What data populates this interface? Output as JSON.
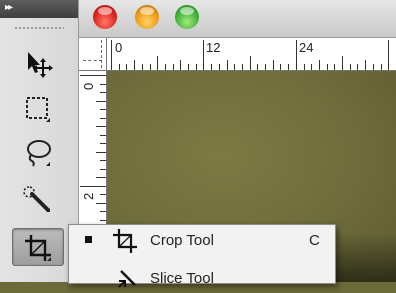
{
  "window": {
    "controls": [
      {
        "name": "close",
        "color": "#e0241c"
      },
      {
        "name": "minimize",
        "color": "#f09a12"
      },
      {
        "name": "zoom",
        "color": "#3fb23a"
      }
    ]
  },
  "tools_panel": {
    "collapse_glyph": "▸▸",
    "tools": [
      {
        "name": "move-tool",
        "icon": "move-arrow-icon"
      },
      {
        "name": "rectangular-marquee-tool",
        "icon": "marquee-icon"
      },
      {
        "name": "lasso-tool",
        "icon": "lasso-icon"
      },
      {
        "name": "quick-selection-tool",
        "icon": "quick-selection-icon"
      },
      {
        "name": "crop-tool",
        "icon": "crop-icon",
        "active": true
      }
    ]
  },
  "rulers": {
    "horizontal_labels": [
      "0",
      "12",
      "24"
    ],
    "vertical_labels": [
      "0",
      "2"
    ]
  },
  "flyout_menu": {
    "items": [
      {
        "label": "Crop Tool",
        "shortcut": "C",
        "icon": "crop-icon",
        "selected": true
      },
      {
        "label": "Slice Tool",
        "shortcut": "",
        "icon": "slice-icon",
        "selected": false
      }
    ]
  },
  "colors": {
    "canvas": "#6e6c3b",
    "toolbar": "#dedede",
    "menu": "#f2f2f2"
  }
}
